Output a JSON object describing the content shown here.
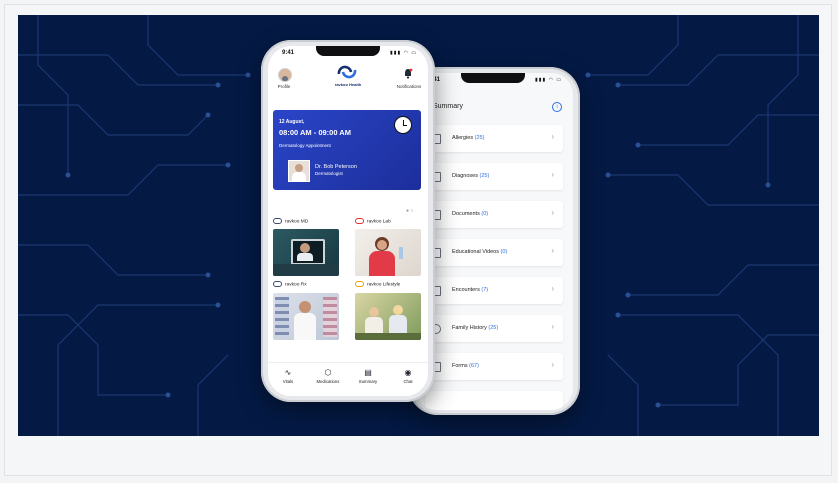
{
  "left_phone": {
    "status_time": "9:41",
    "status_icons": "▮▮▮ ◠ ▭",
    "header": {
      "profile_label": "Profile",
      "brand_name": "ravkoo Health",
      "notifications_label": "Notifications"
    },
    "appointment": {
      "date": "12 August,",
      "time": "08:00 AM - 09:00 AM",
      "type": "Dermatology Appointment",
      "doctor_name": "Dr. Bob Peterson",
      "doctor_role": "Dermatologist"
    },
    "carousel_dots": "● ○",
    "services": [
      {
        "label": "ravkoo MD"
      },
      {
        "label": "ravkoo Lab"
      },
      {
        "label": "ravkoo Rx"
      },
      {
        "label": "ravkoo Lifestyle"
      }
    ],
    "nav": [
      {
        "label": "Vitals",
        "icon": "∿"
      },
      {
        "label": "Medications",
        "icon": "⬡"
      },
      {
        "label": "Summary",
        "icon": "▤"
      },
      {
        "label": "Chat",
        "icon": "◉"
      }
    ]
  },
  "right_phone": {
    "status_time": "9:41",
    "status_icons": "▮▮▮ ◠ ▭",
    "title": "Summary",
    "info_icon": "i",
    "rows": [
      {
        "label": "Allergies",
        "count": "(25)"
      },
      {
        "label": "Diagnoses",
        "count": "(25)"
      },
      {
        "label": "Documents",
        "count": "(0)"
      },
      {
        "label": "Educational Videos",
        "count": "(0)"
      },
      {
        "label": "Encounters",
        "count": "(7)"
      },
      {
        "label": "Family History",
        "count": "(25)"
      },
      {
        "label": "Forms",
        "count": "(67)"
      }
    ],
    "chevron": "›"
  },
  "colors": {
    "background": "#041a45",
    "circuit": "#1f3d7a",
    "appointment_card": "#2a45c8",
    "accent": "#2f6ee0"
  }
}
